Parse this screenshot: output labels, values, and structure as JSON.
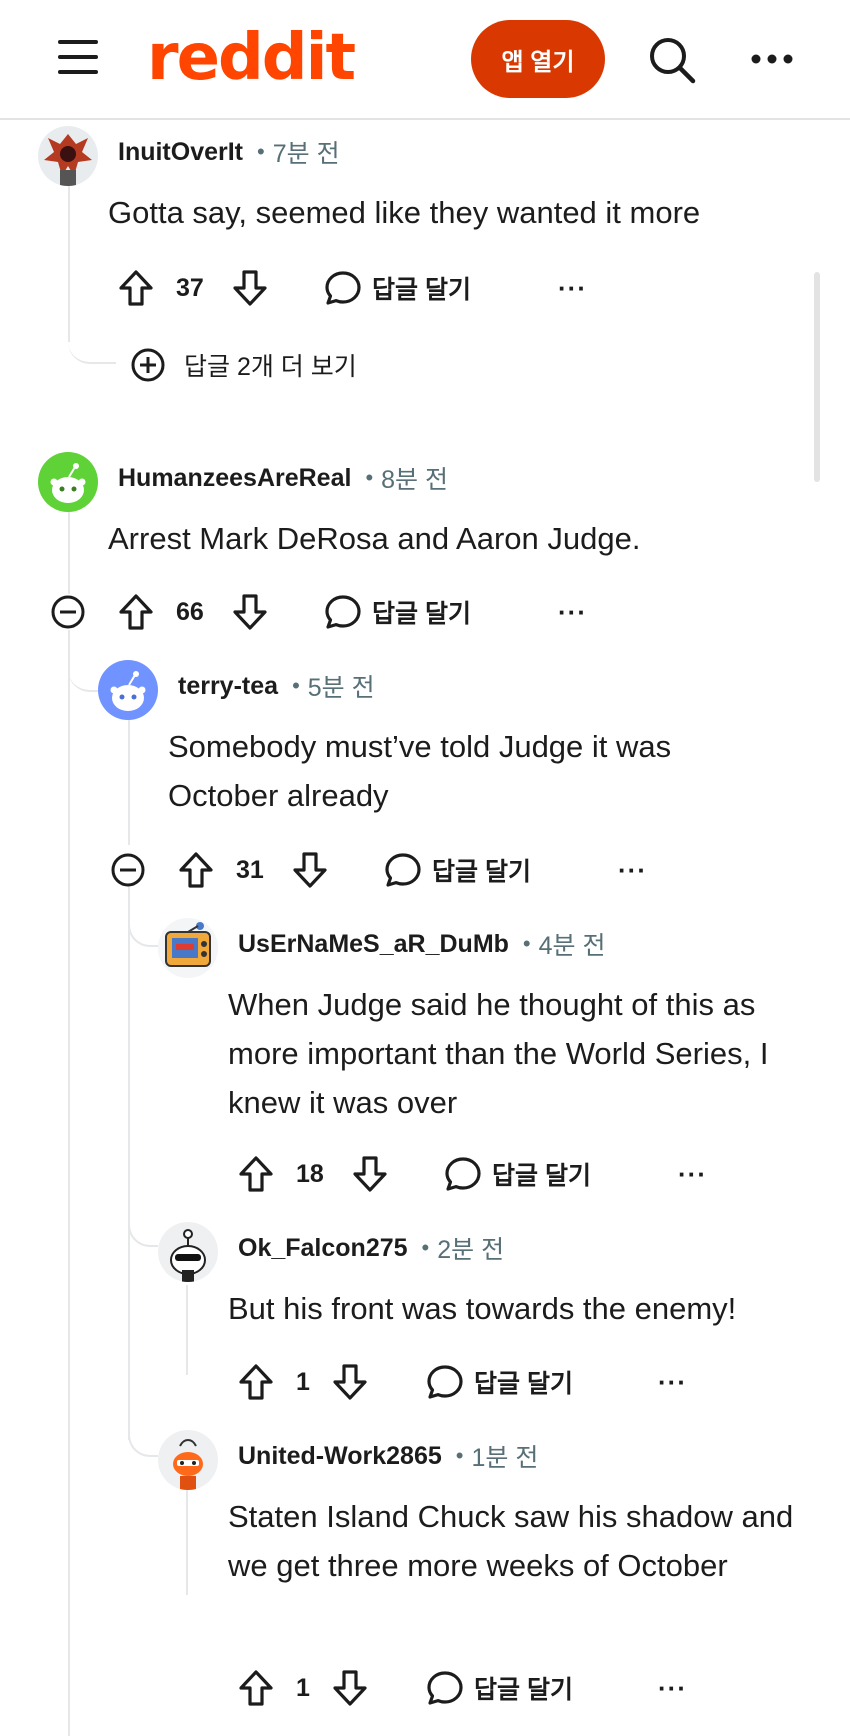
{
  "header": {
    "logo": "reddit",
    "open_app_label": "앱 열기"
  },
  "comments": [
    {
      "username": "InuitOverIt",
      "time": "7분 전",
      "body": "Gotta say, seemed like they wanted it more",
      "votes": "37",
      "reply_label": "답글 달기",
      "more_label": "···",
      "more_replies_label": "답글 2개 더 보기"
    },
    {
      "username": "HumanzeesAreReal",
      "time": "8분 전",
      "body": "Arrest Mark DeRosa and Aaron Judge.",
      "votes": "66",
      "reply_label": "답글 달기",
      "more_label": "···"
    },
    {
      "username": "terry-tea",
      "time": "5분 전",
      "body": "Somebody must’ve told Judge it was October already",
      "votes": "31",
      "reply_label": "답글 달기",
      "more_label": "···"
    },
    {
      "username": "UsErNaMeS_aR_DuMb",
      "time": "4분 전",
      "body": "When Judge said he thought of this as more important than the World Series, I knew it was over",
      "votes": "18",
      "reply_label": "답글 달기",
      "more_label": "···"
    },
    {
      "username": "Ok_Falcon275",
      "time": "2분 전",
      "body": "But his front was towards the enemy!",
      "votes": "1",
      "reply_label": "답글 달기",
      "more_label": "···"
    },
    {
      "username": "United-Work2865",
      "time": "1분 전",
      "body": "Staten Island Chuck saw his shadow and we get three more weeks of October",
      "votes": "1",
      "reply_label": "답글 달기",
      "more_label": "···"
    }
  ],
  "colors": {
    "brand": "#ff4500",
    "open_app_button": "#d93900",
    "thread_line": "#e5e7e9",
    "meta_text": "#576f76"
  },
  "icons": [
    "menu-icon",
    "search-icon",
    "more-options-icon",
    "upvote-icon",
    "downvote-icon",
    "comment-icon",
    "plus-circle-icon",
    "minus-circle-icon"
  ]
}
